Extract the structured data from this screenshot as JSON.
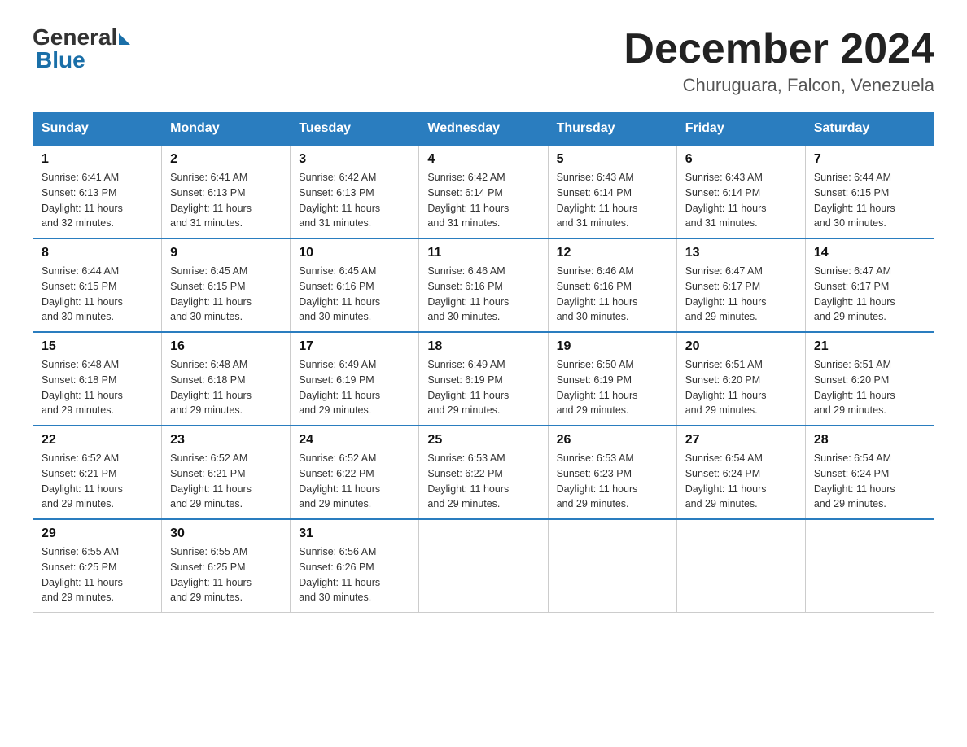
{
  "logo": {
    "general": "General",
    "blue": "Blue"
  },
  "title": "December 2024",
  "location": "Churuguara, Falcon, Venezuela",
  "headers": [
    "Sunday",
    "Monday",
    "Tuesday",
    "Wednesday",
    "Thursday",
    "Friday",
    "Saturday"
  ],
  "weeks": [
    [
      {
        "day": "1",
        "sunrise": "6:41 AM",
        "sunset": "6:13 PM",
        "daylight": "11 hours and 32 minutes."
      },
      {
        "day": "2",
        "sunrise": "6:41 AM",
        "sunset": "6:13 PM",
        "daylight": "11 hours and 31 minutes."
      },
      {
        "day": "3",
        "sunrise": "6:42 AM",
        "sunset": "6:13 PM",
        "daylight": "11 hours and 31 minutes."
      },
      {
        "day": "4",
        "sunrise": "6:42 AM",
        "sunset": "6:14 PM",
        "daylight": "11 hours and 31 minutes."
      },
      {
        "day": "5",
        "sunrise": "6:43 AM",
        "sunset": "6:14 PM",
        "daylight": "11 hours and 31 minutes."
      },
      {
        "day": "6",
        "sunrise": "6:43 AM",
        "sunset": "6:14 PM",
        "daylight": "11 hours and 31 minutes."
      },
      {
        "day": "7",
        "sunrise": "6:44 AM",
        "sunset": "6:15 PM",
        "daylight": "11 hours and 30 minutes."
      }
    ],
    [
      {
        "day": "8",
        "sunrise": "6:44 AM",
        "sunset": "6:15 PM",
        "daylight": "11 hours and 30 minutes."
      },
      {
        "day": "9",
        "sunrise": "6:45 AM",
        "sunset": "6:15 PM",
        "daylight": "11 hours and 30 minutes."
      },
      {
        "day": "10",
        "sunrise": "6:45 AM",
        "sunset": "6:16 PM",
        "daylight": "11 hours and 30 minutes."
      },
      {
        "day": "11",
        "sunrise": "6:46 AM",
        "sunset": "6:16 PM",
        "daylight": "11 hours and 30 minutes."
      },
      {
        "day": "12",
        "sunrise": "6:46 AM",
        "sunset": "6:16 PM",
        "daylight": "11 hours and 30 minutes."
      },
      {
        "day": "13",
        "sunrise": "6:47 AM",
        "sunset": "6:17 PM",
        "daylight": "11 hours and 29 minutes."
      },
      {
        "day": "14",
        "sunrise": "6:47 AM",
        "sunset": "6:17 PM",
        "daylight": "11 hours and 29 minutes."
      }
    ],
    [
      {
        "day": "15",
        "sunrise": "6:48 AM",
        "sunset": "6:18 PM",
        "daylight": "11 hours and 29 minutes."
      },
      {
        "day": "16",
        "sunrise": "6:48 AM",
        "sunset": "6:18 PM",
        "daylight": "11 hours and 29 minutes."
      },
      {
        "day": "17",
        "sunrise": "6:49 AM",
        "sunset": "6:19 PM",
        "daylight": "11 hours and 29 minutes."
      },
      {
        "day": "18",
        "sunrise": "6:49 AM",
        "sunset": "6:19 PM",
        "daylight": "11 hours and 29 minutes."
      },
      {
        "day": "19",
        "sunrise": "6:50 AM",
        "sunset": "6:19 PM",
        "daylight": "11 hours and 29 minutes."
      },
      {
        "day": "20",
        "sunrise": "6:51 AM",
        "sunset": "6:20 PM",
        "daylight": "11 hours and 29 minutes."
      },
      {
        "day": "21",
        "sunrise": "6:51 AM",
        "sunset": "6:20 PM",
        "daylight": "11 hours and 29 minutes."
      }
    ],
    [
      {
        "day": "22",
        "sunrise": "6:52 AM",
        "sunset": "6:21 PM",
        "daylight": "11 hours and 29 minutes."
      },
      {
        "day": "23",
        "sunrise": "6:52 AM",
        "sunset": "6:21 PM",
        "daylight": "11 hours and 29 minutes."
      },
      {
        "day": "24",
        "sunrise": "6:52 AM",
        "sunset": "6:22 PM",
        "daylight": "11 hours and 29 minutes."
      },
      {
        "day": "25",
        "sunrise": "6:53 AM",
        "sunset": "6:22 PM",
        "daylight": "11 hours and 29 minutes."
      },
      {
        "day": "26",
        "sunrise": "6:53 AM",
        "sunset": "6:23 PM",
        "daylight": "11 hours and 29 minutes."
      },
      {
        "day": "27",
        "sunrise": "6:54 AM",
        "sunset": "6:24 PM",
        "daylight": "11 hours and 29 minutes."
      },
      {
        "day": "28",
        "sunrise": "6:54 AM",
        "sunset": "6:24 PM",
        "daylight": "11 hours and 29 minutes."
      }
    ],
    [
      {
        "day": "29",
        "sunrise": "6:55 AM",
        "sunset": "6:25 PM",
        "daylight": "11 hours and 29 minutes."
      },
      {
        "day": "30",
        "sunrise": "6:55 AM",
        "sunset": "6:25 PM",
        "daylight": "11 hours and 29 minutes."
      },
      {
        "day": "31",
        "sunrise": "6:56 AM",
        "sunset": "6:26 PM",
        "daylight": "11 hours and 30 minutes."
      },
      null,
      null,
      null,
      null
    ]
  ],
  "labels": {
    "sunrise": "Sunrise:",
    "sunset": "Sunset:",
    "daylight": "Daylight:"
  }
}
